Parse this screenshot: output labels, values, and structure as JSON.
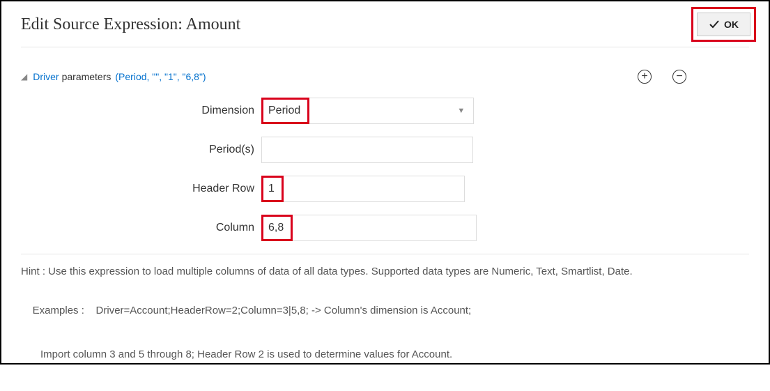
{
  "header": {
    "title": "Edit Source Expression: Amount",
    "ok_label": "OK"
  },
  "driver": {
    "link_text": "Driver",
    "label_text": "parameters",
    "params_text": "(Period, \"\", \"1\", \"6,8\")"
  },
  "fields": {
    "dimension": {
      "label": "Dimension",
      "value": "Period"
    },
    "periods": {
      "label": "Period(s)",
      "value": ""
    },
    "header_row": {
      "label": "Header Row",
      "value": "1"
    },
    "column": {
      "label": "Column",
      "value": "6,8"
    }
  },
  "hint": "Hint : Use this expression to load multiple columns of data of all data types. Supported data types are Numeric, Text, Smartlist, Date.",
  "examples": {
    "line1": "Examples :    Driver=Account;HeaderRow=2;Column=3|5,8; -> Column's dimension is Account;",
    "line2": "Import column 3 and 5 through 8; Header Row 2 is used to determine values for Account."
  }
}
